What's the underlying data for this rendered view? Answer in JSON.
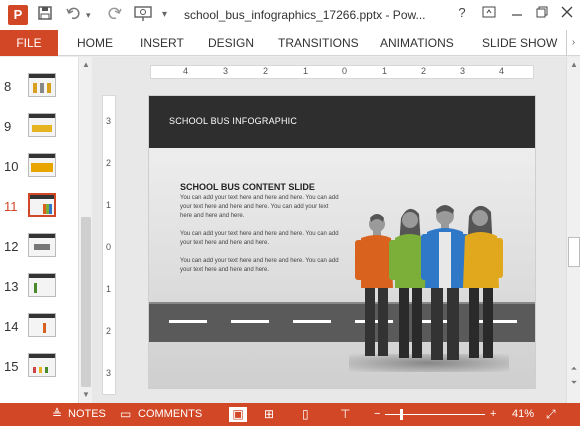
{
  "window": {
    "title": "school_bus_infographics_17266.pptx - Pow...",
    "app_icon_letter": "P",
    "help_label": "?",
    "accent_color": "#d24726"
  },
  "quick_access": {
    "save_icon": "save-icon",
    "undo_icon": "undo-icon",
    "redo_icon": "redo-icon",
    "present_icon": "present-from-start-icon",
    "customize_icon": "customize-qat-icon"
  },
  "ribbon": {
    "tabs": [
      "FILE",
      "HOME",
      "INSERT",
      "DESIGN",
      "TRANSITIONS",
      "ANIMATIONS",
      "SLIDE SHOW"
    ]
  },
  "thumbnails": {
    "numbers": [
      "8",
      "9",
      "10",
      "11",
      "12",
      "13",
      "14",
      "15"
    ],
    "active": "11"
  },
  "rulers": {
    "horizontal": [
      "4",
      "3",
      "2",
      "1",
      "0",
      "1",
      "2",
      "3",
      "4"
    ],
    "vertical": [
      "3",
      "2",
      "1",
      "0",
      "1",
      "2",
      "3"
    ]
  },
  "slide": {
    "header_title": "SCHOOL BUS INFOGRAPHIC",
    "content_title": "SCHOOL BUS CONTENT SLIDE",
    "paragraphs": [
      "You can add your text here and here and here. You can add your text here and here and here. You can add your text here and here and here.",
      "You can add your text here and here and here. You can add your text here and here and here.",
      "You can add your text here and here and here. You can add your text here and here and here."
    ],
    "colors": {
      "header": "#2e2e2e",
      "road": "#5a5a5a",
      "figure_orange": "#d9621f",
      "figure_green": "#7cae3a",
      "figure_blue": "#2f78c8",
      "figure_yellow": "#e2a81d"
    }
  },
  "statusbar": {
    "notes_label": "NOTES",
    "comments_label": "COMMENTS",
    "zoom_label": "41%",
    "zoom_minus": "−",
    "zoom_plus": "+"
  }
}
